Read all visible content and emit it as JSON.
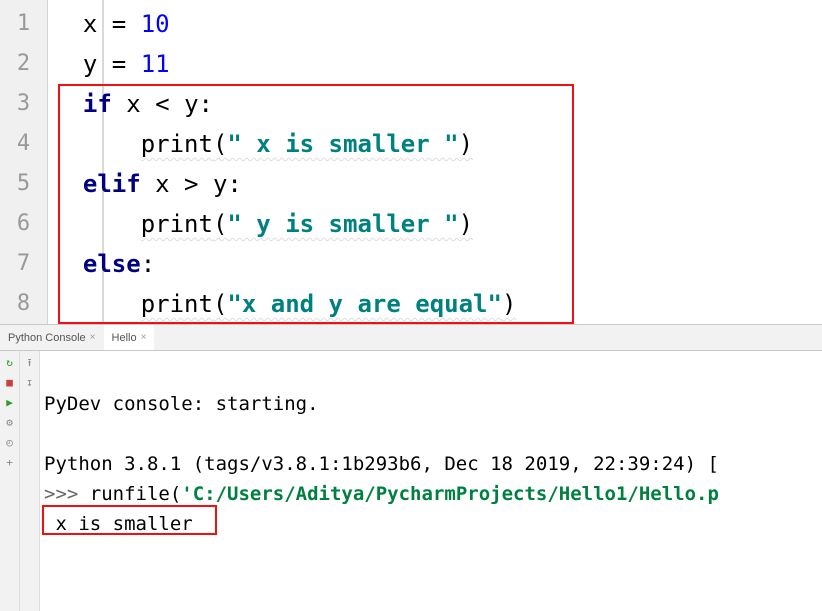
{
  "editor": {
    "lines": [
      {
        "num": "1",
        "segments": [
          {
            "t": "x = ",
            "c": "tok-plain"
          },
          {
            "t": "10",
            "c": "tok-num"
          }
        ]
      },
      {
        "num": "2",
        "segments": [
          {
            "t": "y = ",
            "c": "tok-plain"
          },
          {
            "t": "11",
            "c": "tok-num"
          }
        ]
      },
      {
        "num": "3",
        "segments": [
          {
            "t": "if ",
            "c": "tok-kw"
          },
          {
            "t": "x < y:",
            "c": "tok-plain"
          }
        ]
      },
      {
        "num": "4",
        "indent": "    ",
        "wavy": true,
        "segments": [
          {
            "t": "print",
            "c": "tok-plain"
          },
          {
            "t": "(",
            "c": "tok-par"
          },
          {
            "t": "\" x is smaller \"",
            "c": "tok-str"
          },
          {
            "t": ")",
            "c": "tok-par"
          }
        ]
      },
      {
        "num": "5",
        "segments": [
          {
            "t": "elif ",
            "c": "tok-kw"
          },
          {
            "t": "x > y:",
            "c": "tok-plain"
          }
        ]
      },
      {
        "num": "6",
        "indent": "    ",
        "wavy": true,
        "segments": [
          {
            "t": "print",
            "c": "tok-plain"
          },
          {
            "t": "(",
            "c": "tok-par"
          },
          {
            "t": "\" y is smaller \"",
            "c": "tok-str"
          },
          {
            "t": ")",
            "c": "tok-par"
          }
        ]
      },
      {
        "num": "7",
        "segments": [
          {
            "t": "else",
            "c": "tok-kw"
          },
          {
            "t": ":",
            "c": "tok-plain"
          }
        ]
      },
      {
        "num": "8",
        "indent": "    ",
        "wavy": true,
        "segments": [
          {
            "t": "print",
            "c": "tok-plain"
          },
          {
            "t": "(",
            "c": "tok-par"
          },
          {
            "t": "\"x and y are equal\"",
            "c": "tok-str"
          },
          {
            "t": ")",
            "c": "tok-par"
          }
        ]
      }
    ]
  },
  "tabs": {
    "items": [
      {
        "label": "Python Console",
        "active": false
      },
      {
        "label": "Hello",
        "active": true
      }
    ]
  },
  "toolbar": {
    "rerun": "↻",
    "stop": "■",
    "play": "▶",
    "bug": "⚙",
    "history": "◴",
    "plus": "+",
    "top": "⭱",
    "down": "↧"
  },
  "console": {
    "start": "PyDev console: starting.",
    "blank": " ",
    "versionLine": "Python 3.8.1 (tags/v3.8.1:1b293b6, Dec 18 2019, 22:39:24) [",
    "prompt": ">>> ",
    "runfilePrefix": "runfile(",
    "runfilePath": "'C:/Users/Aditya/PycharmProjects/Hello1/Hello.p",
    "output": " x is smaller "
  }
}
